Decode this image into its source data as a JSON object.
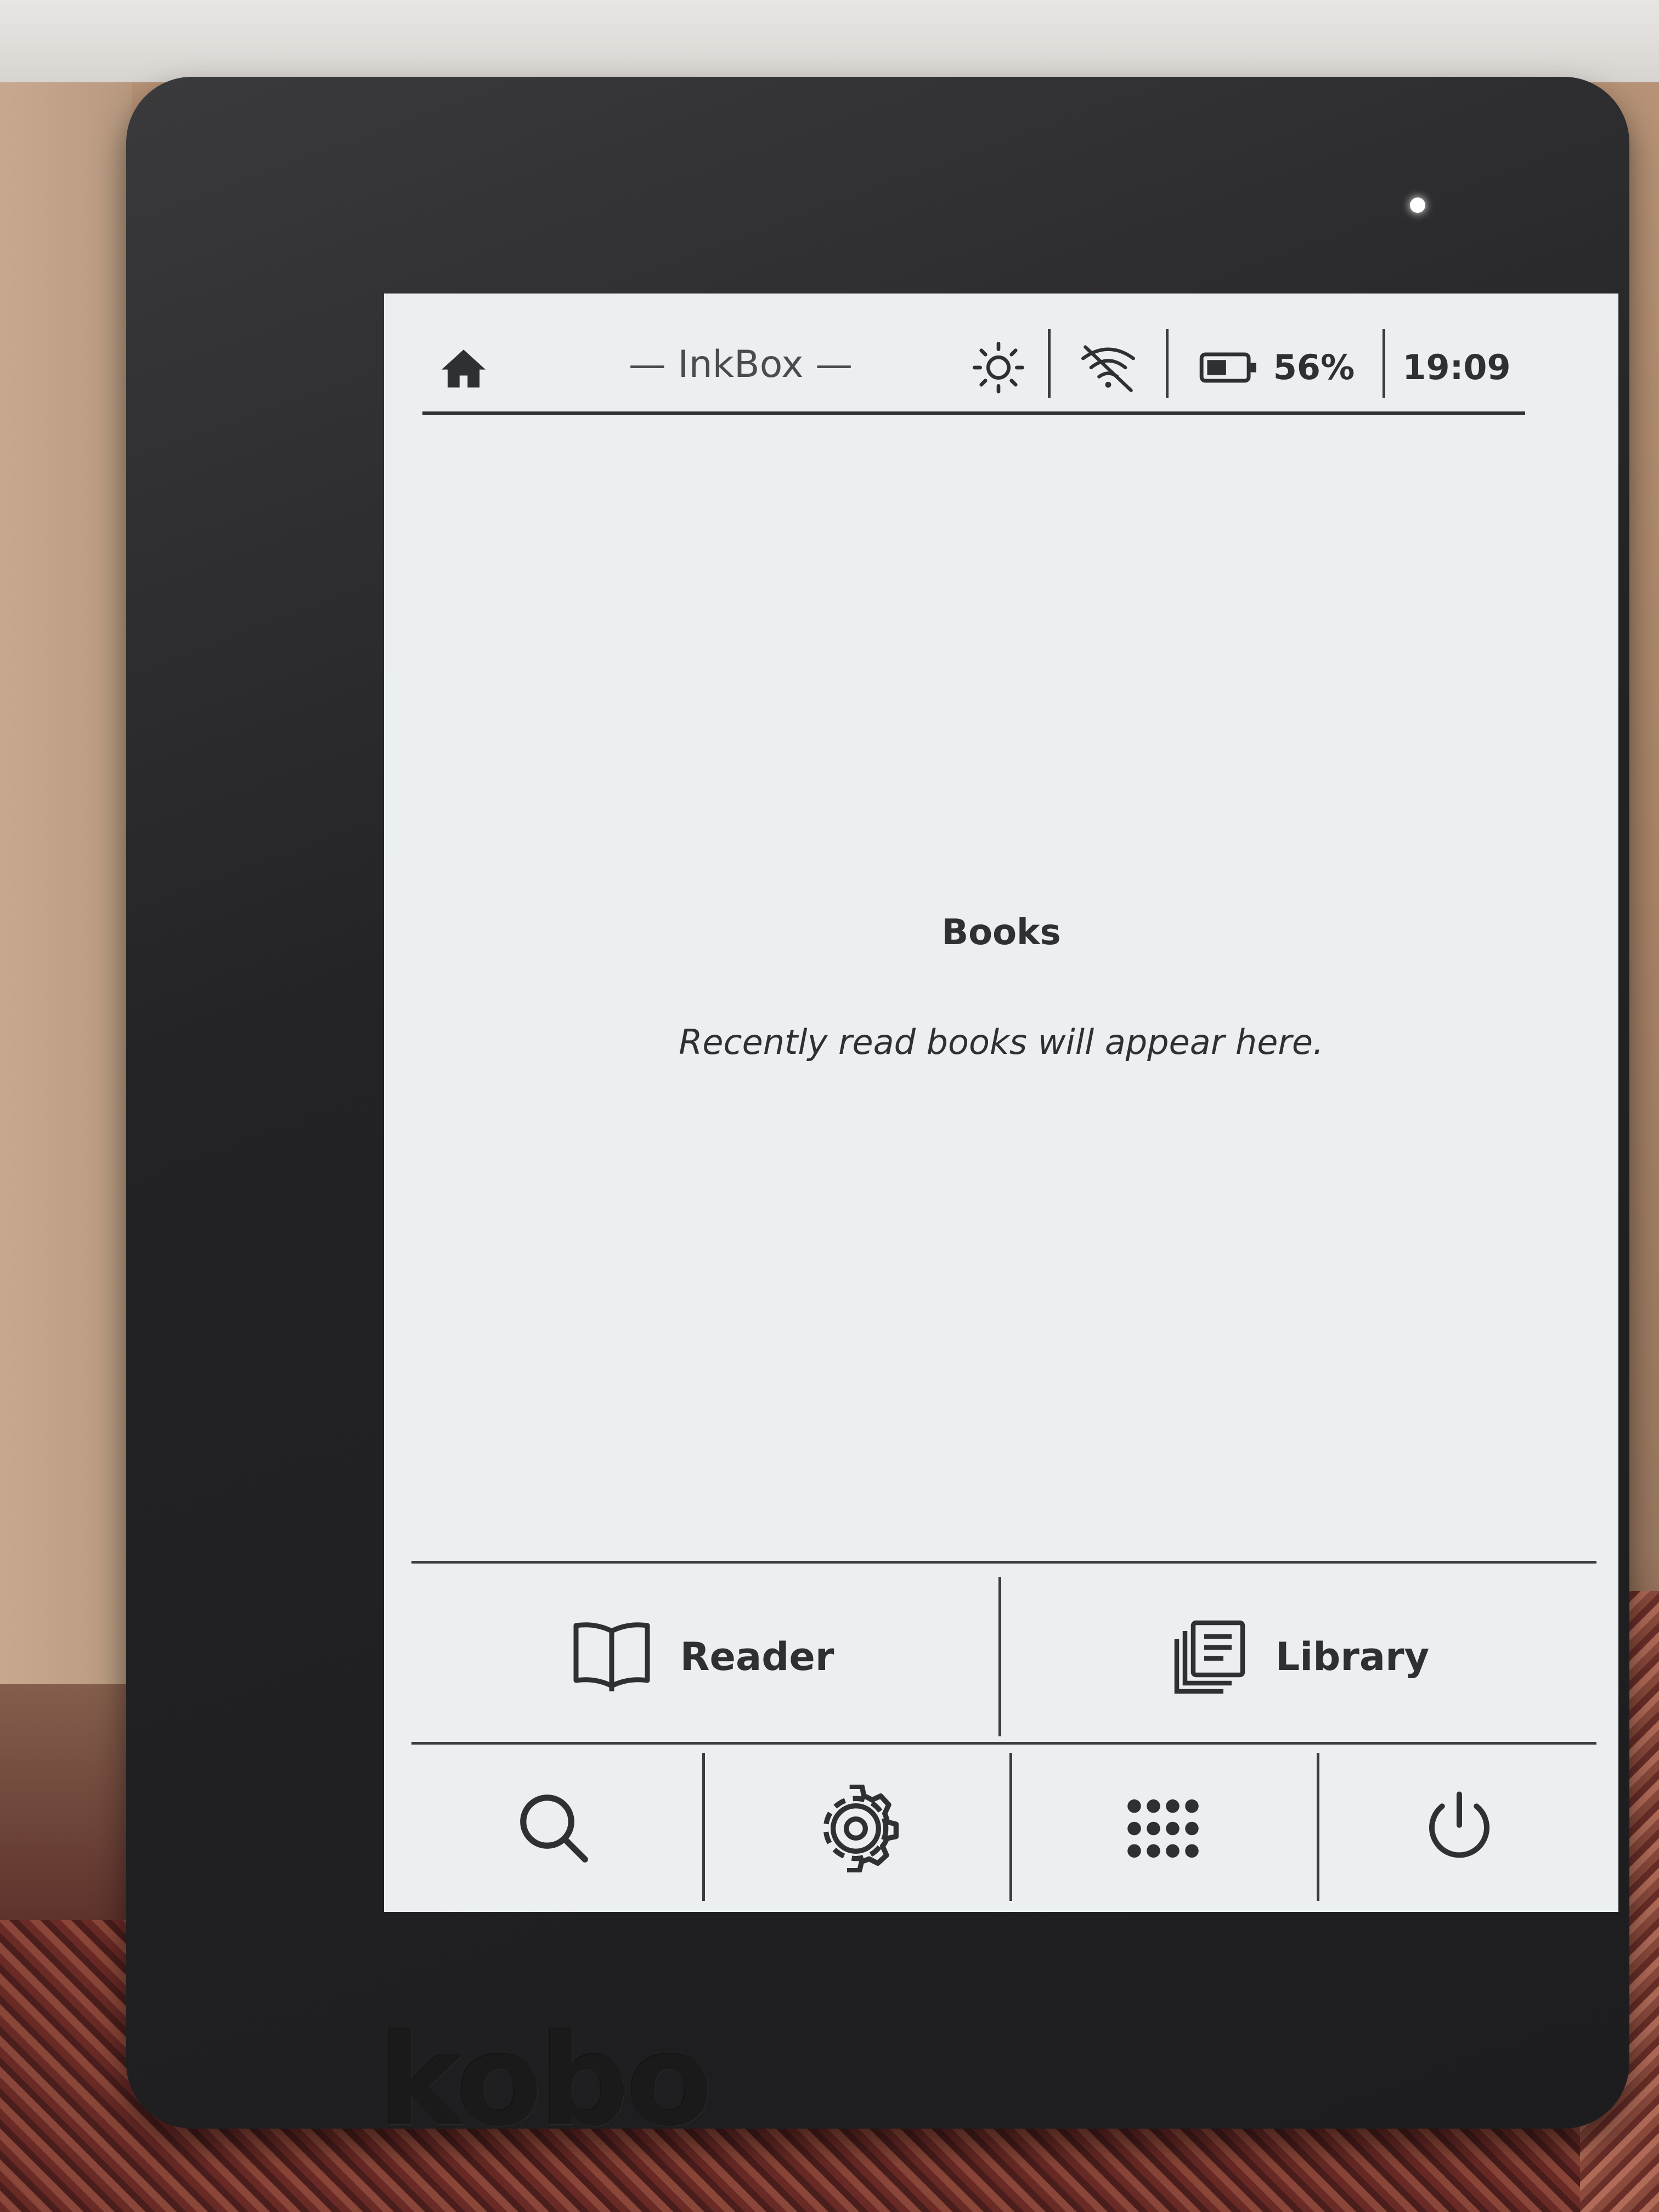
{
  "statusbar": {
    "app_title": "— InkBox —",
    "battery": "56%",
    "time": "19:09",
    "icons": [
      "home-icon",
      "brightness-icon",
      "wifi-off-icon",
      "battery-icon"
    ]
  },
  "main": {
    "section_title": "Books",
    "empty_message": "Recently read books will appear here."
  },
  "nav": {
    "reader_label": "Reader",
    "library_label": "Library"
  },
  "toolbar": {
    "icons": [
      "search-icon",
      "gear-icon",
      "apps-grid-icon",
      "power-icon"
    ]
  },
  "device": {
    "brand": "kobo"
  },
  "colors": {
    "screen": "#ebeff0",
    "ink": "#2e3033",
    "bezel": "#232325"
  }
}
